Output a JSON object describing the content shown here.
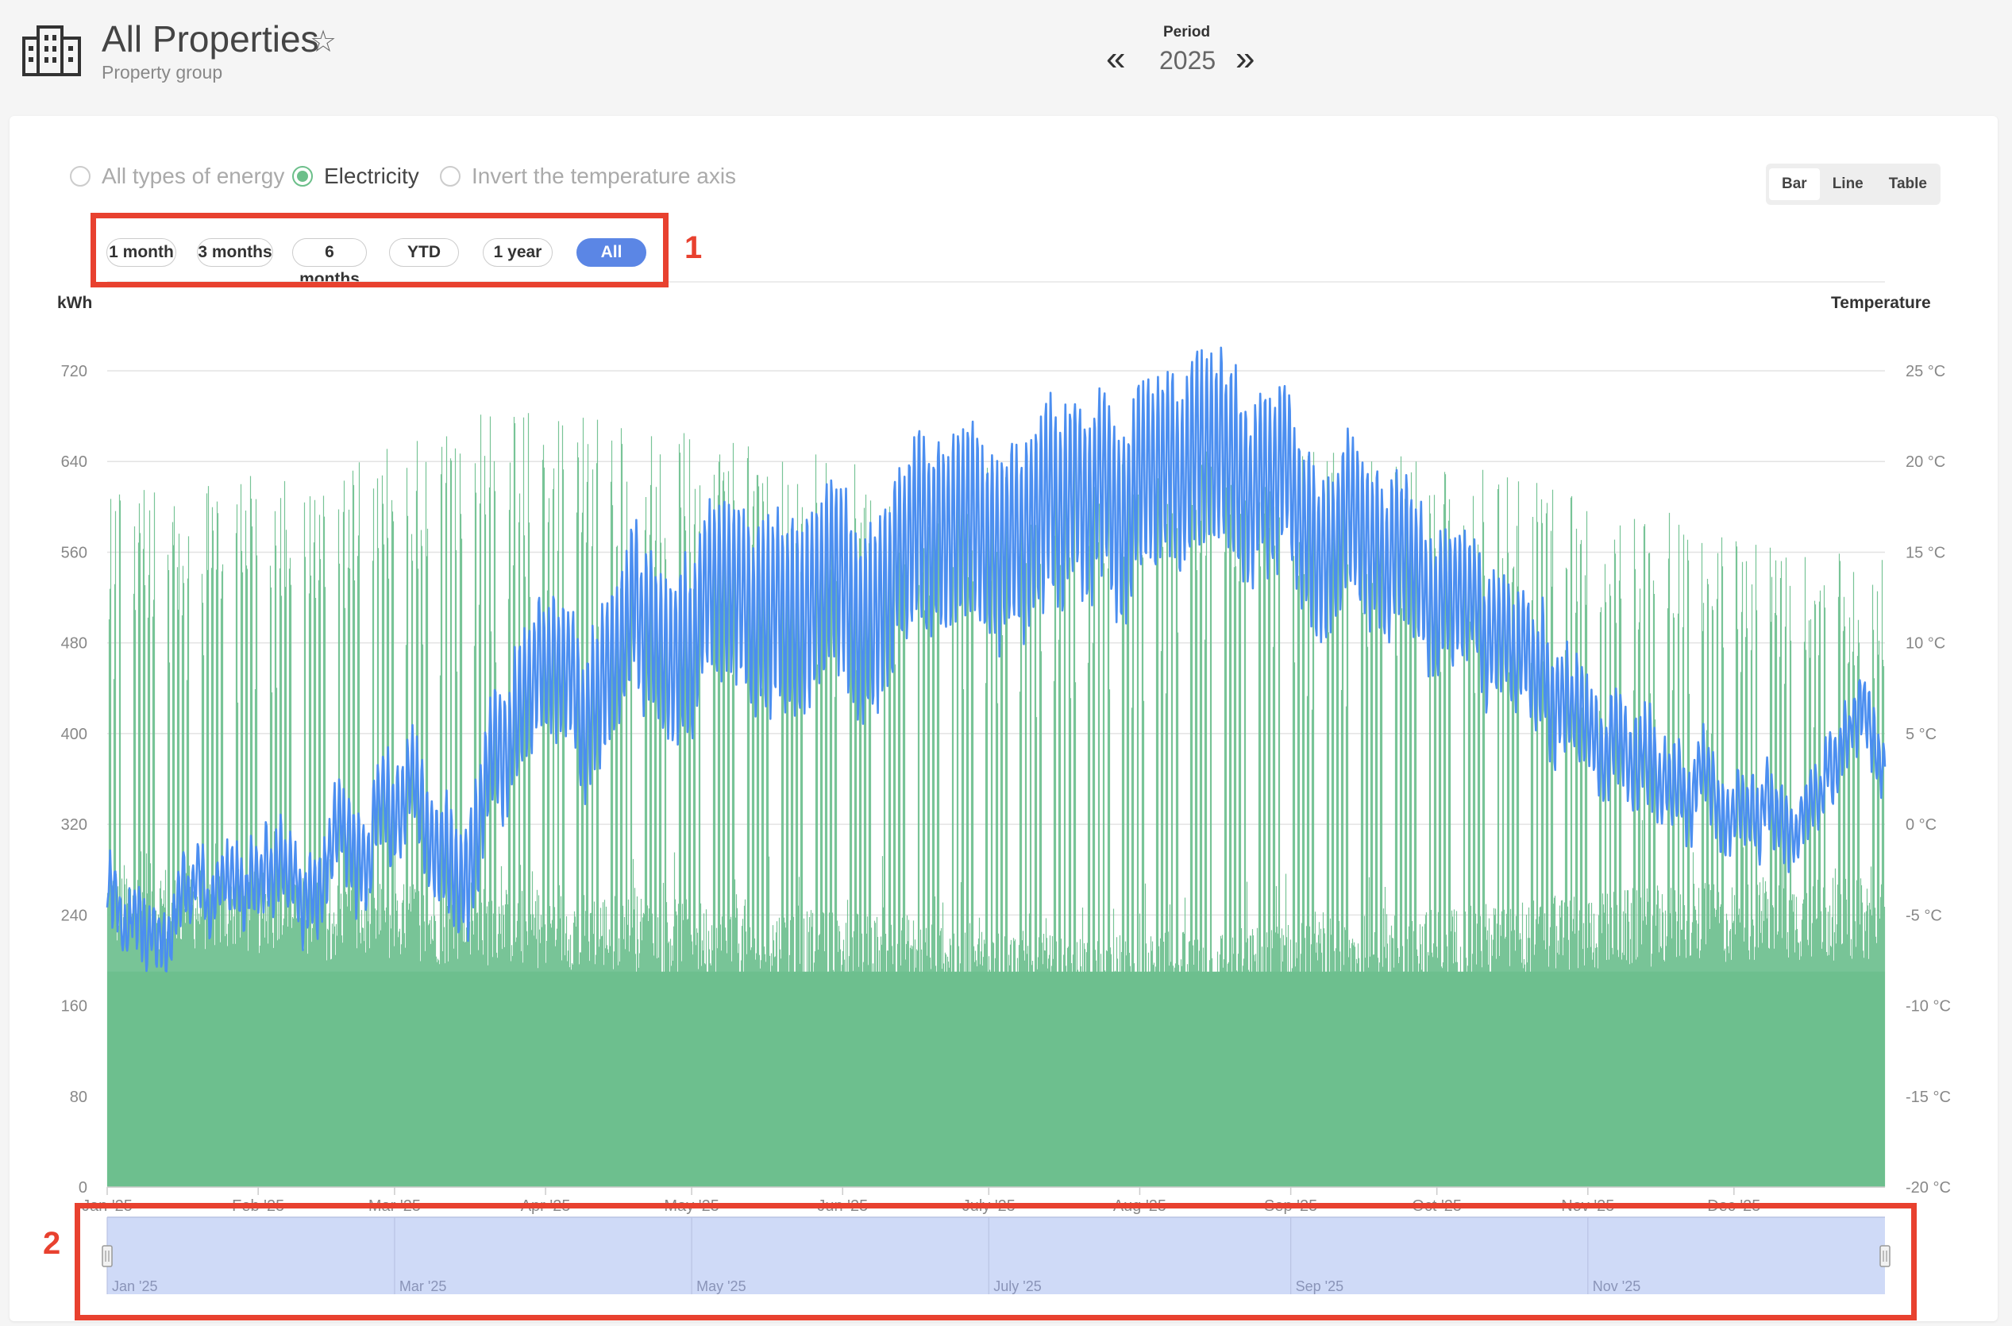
{
  "header": {
    "title": "All Properties",
    "subtitle": "Property group",
    "period_label": "Period",
    "period_value": "2025",
    "icon": "building-icon"
  },
  "filters": {
    "energy_options": [
      {
        "label": "All types of energy",
        "checked": false
      },
      {
        "label": "Electricity",
        "checked": true
      },
      {
        "label": "Invert the temperature axis",
        "checked": false
      }
    ],
    "view_modes": [
      "Bar",
      "Line",
      "Table"
    ],
    "active_view": "Bar",
    "ranges": [
      "1 month",
      "3 months",
      "6 months",
      "YTD",
      "1 year",
      "All"
    ],
    "active_range": "All"
  },
  "annotations": [
    "1",
    "2"
  ],
  "colors": {
    "bars": "#6dbf8e",
    "temperature_line": "#4b8ef0",
    "navigator_fill": "#cfdaf7",
    "active_button": "#5b86e5",
    "annotation": "#e8412f"
  },
  "chart_data": {
    "type": "bar",
    "left_axis": {
      "label": "kWh",
      "ticks": [
        "0",
        "80",
        "160",
        "240",
        "320",
        "400",
        "480",
        "560",
        "640",
        "720"
      ],
      "range": [
        0,
        720
      ]
    },
    "right_axis": {
      "label": "Temperature",
      "ticks": [
        "-20 °C",
        "-15 °C",
        "-10 °C",
        "-5 °C",
        "0 °C",
        "5 °C",
        "10 °C",
        "15 °C",
        "20 °C",
        "25 °C"
      ],
      "range": [
        -20,
        25
      ]
    },
    "x_ticks": [
      "Jan '25",
      "Feb '25",
      "Mar '25",
      "Apr '25",
      "May '25",
      "Jun '25",
      "July '25",
      "Aug '25",
      "Sep '25",
      "Oct '25",
      "Nov '25",
      "Dec '25"
    ],
    "navigator_ticks": [
      "Jan '25",
      "Mar '25",
      "May '25",
      "July '25",
      "Sep '25",
      "Nov '25"
    ],
    "series": [
      {
        "type": "bar",
        "resolution": "hourly",
        "weekly_pattern": "5 working days, 2 weekend days",
        "monthly_profile": {
          "months": [
            "Jan",
            "Feb",
            "Mar",
            "Apr",
            "May",
            "Jun",
            "Jul",
            "Aug",
            "Sep",
            "Oct",
            "Nov",
            "Dec"
          ],
          "night_base_kwh": [
            220,
            210,
            205,
            200,
            190,
            185,
            170,
            175,
            185,
            195,
            205,
            210
          ],
          "workday_peak_kwh": [
            620,
            640,
            690,
            680,
            650,
            640,
            660,
            660,
            650,
            630,
            600,
            560
          ]
        }
      },
      {
        "type": "line",
        "resolution": "hourly",
        "monthly_mean_temp_c": [
          -3.5,
          -3,
          4,
          9,
          11,
          15,
          19,
          20.5,
          15,
          9,
          3,
          2
        ],
        "diurnal_amplitude_c": [
          1.5,
          2,
          3,
          4,
          5,
          5,
          5,
          5,
          4,
          3,
          2,
          1.5
        ]
      }
    ]
  }
}
